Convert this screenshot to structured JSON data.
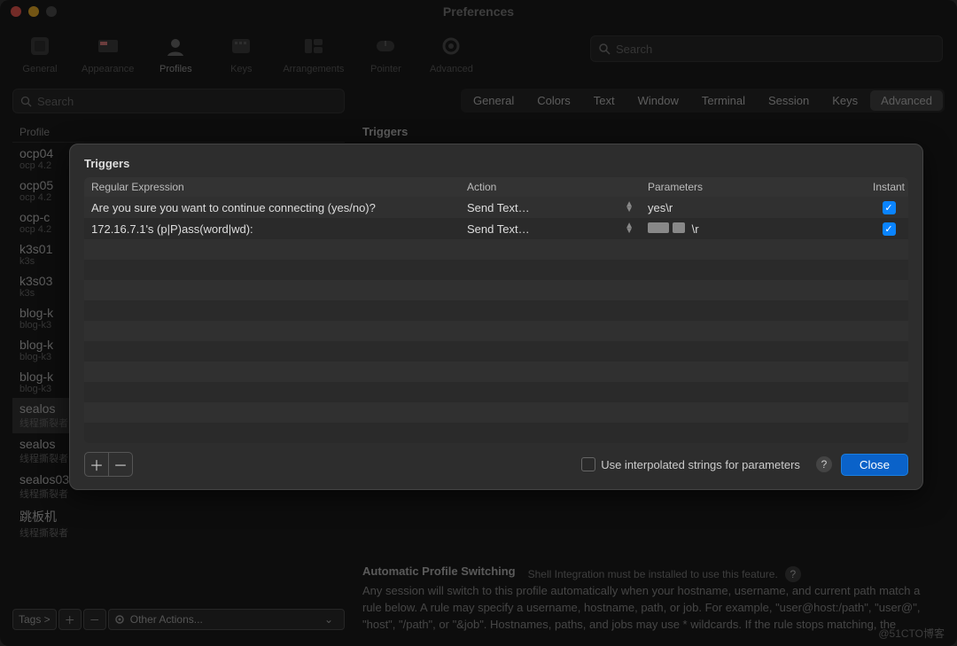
{
  "window": {
    "title": "Preferences"
  },
  "toolbar": {
    "items": [
      {
        "id": "general",
        "label": "General"
      },
      {
        "id": "appearance",
        "label": "Appearance"
      },
      {
        "id": "profiles",
        "label": "Profiles",
        "active": true
      },
      {
        "id": "keys",
        "label": "Keys"
      },
      {
        "id": "arrangements",
        "label": "Arrangements"
      },
      {
        "id": "pointer",
        "label": "Pointer"
      },
      {
        "id": "advanced",
        "label": "Advanced"
      }
    ],
    "search_placeholder": "Search"
  },
  "sidebar": {
    "search_placeholder": "Search",
    "header": "Profile",
    "profiles": [
      {
        "name": "ocp04",
        "sub": "ocp 4.2"
      },
      {
        "name": "ocp05",
        "sub": "ocp 4.2"
      },
      {
        "name": "ocp-c",
        "sub": "ocp 4.2"
      },
      {
        "name": "k3s01",
        "sub": "k3s"
      },
      {
        "name": "k3s03",
        "sub": "k3s"
      },
      {
        "name": "blog-k",
        "sub": "blog-k3"
      },
      {
        "name": "blog-k",
        "sub": "blog-k3"
      },
      {
        "name": "blog-k",
        "sub": "blog-k3"
      },
      {
        "name": "sealos",
        "sub": "线程撕裂者",
        "sel": true
      },
      {
        "name": "sealos",
        "sub": "线程撕裂者"
      },
      {
        "name": "sealos03",
        "sub": "线程撕裂者"
      },
      {
        "name": "跳板机",
        "sub": "线程撕裂者"
      }
    ],
    "tags_label": "Tags >",
    "other_actions": "Other Actions..."
  },
  "profile_tabs": [
    "General",
    "Colors",
    "Text",
    "Window",
    "Terminal",
    "Session",
    "Keys",
    "Advanced"
  ],
  "profile_tabs_active": "Advanced",
  "section": {
    "triggers": "Triggers",
    "aps_title": "Automatic Profile Switching",
    "aps_note": "Shell Integration must be installed to use this feature.",
    "aps_desc": "Any session will switch to this profile automatically when your hostname, username, and current path match a rule below. A rule may specify a username, hostname, path, or job. For example, \"user@host:/path\", \"user@\", \"host\", \"/path\", or \"&job\". Hostnames, paths, and jobs may use * wildcards. If the rule stops matching, the"
  },
  "modal": {
    "title": "Triggers",
    "columns": {
      "regex": "Regular Expression",
      "action": "Action",
      "params": "Parameters",
      "instant": "Instant"
    },
    "rows": [
      {
        "regex": "Are you sure you want to continue connecting (yes/no)?",
        "action": "Send Text…",
        "params": "yes\\r",
        "instant": true,
        "masked": false
      },
      {
        "regex": "172.16.7.1's (p|P)ass(word|wd):",
        "action": "Send Text…",
        "params": "\\r",
        "instant": true,
        "masked": true
      }
    ],
    "interp_label": "Use interpolated strings for parameters",
    "close": "Close"
  },
  "watermark": "@51CTO博客"
}
